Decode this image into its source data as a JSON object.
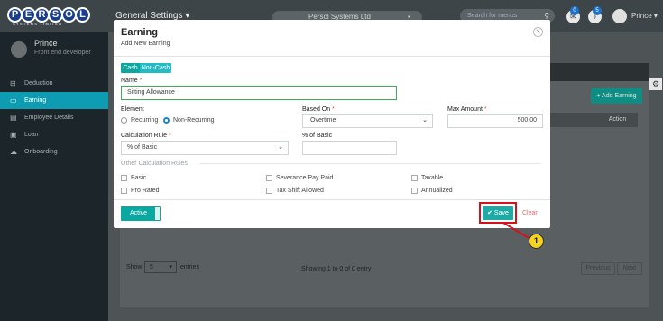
{
  "topbar": {
    "logo_text": "PERSOL",
    "logo_subtext": "SYSTEMS LIMITED",
    "general_settings": "General Settings",
    "company": "Persol Systems Ltd",
    "search_placeholder": "Search for menus",
    "messages_count": "0",
    "notifications_count": "5",
    "user_name": "Prince"
  },
  "sidebar": {
    "profile_name": "Prince",
    "profile_role": "Front end developer",
    "items": [
      {
        "label": "Deduction",
        "icon": "minus-square-icon",
        "glyph": "⊟"
      },
      {
        "label": "Earning",
        "icon": "money-icon",
        "glyph": "▭"
      },
      {
        "label": "Employee Details",
        "icon": "id-card-icon",
        "glyph": "▤"
      },
      {
        "label": "Loan",
        "icon": "loan-icon",
        "glyph": "▣"
      },
      {
        "label": "Onboarding",
        "icon": "cloud-icon",
        "glyph": "☁"
      }
    ],
    "active_item": "Earning"
  },
  "page": {
    "add_earning_label": "+ Add Earning",
    "action_header": "Action",
    "show_label": "Show",
    "show_value": "5",
    "entries_label": "entries",
    "showing_info": "Showing 1 to 0 of 0 entry",
    "previous_label": "Previous",
    "next_label": "Next"
  },
  "modal": {
    "title": "Earning",
    "subtitle": "Add New Earning",
    "tabs": {
      "cash": "Cash",
      "non_cash": "Non-Cash"
    },
    "name_label": "Name",
    "name_value": "Sitting Allowance",
    "element_label": "Element",
    "element_options": {
      "recurring": "Recurring",
      "non_recurring": "Non-Recurring"
    },
    "element_selected": "Non-Recurring",
    "based_on_label": "Based On",
    "based_on_value": "Overtime",
    "max_amount_label": "Max Amount",
    "max_amount_value": "500.00",
    "calc_rule_label": "Calculation Rule",
    "calc_rule_value": "% of Basic",
    "pct_basic_label": "% of Basic",
    "pct_basic_value": "",
    "other_rules_label": "Other Calculation Rules",
    "rules": {
      "basic": "Basic",
      "severance": "Severance Pay Paid",
      "taxable": "Taxable",
      "pro_rated": "Pro Rated",
      "tax_shift": "Tax Shift Allowed",
      "annualized": "Annualized"
    },
    "active_label": "Active",
    "save_label": "✔ Save",
    "clear_label": "Clear",
    "required_mark": "*"
  },
  "annotation": {
    "step": "1",
    "highlight_color": "#d5121b",
    "marker_color": "#f6d41e"
  },
  "colors": {
    "accent": "#0aa8a0",
    "active_nav": "#0e9cb3",
    "required": "#d9534f"
  }
}
